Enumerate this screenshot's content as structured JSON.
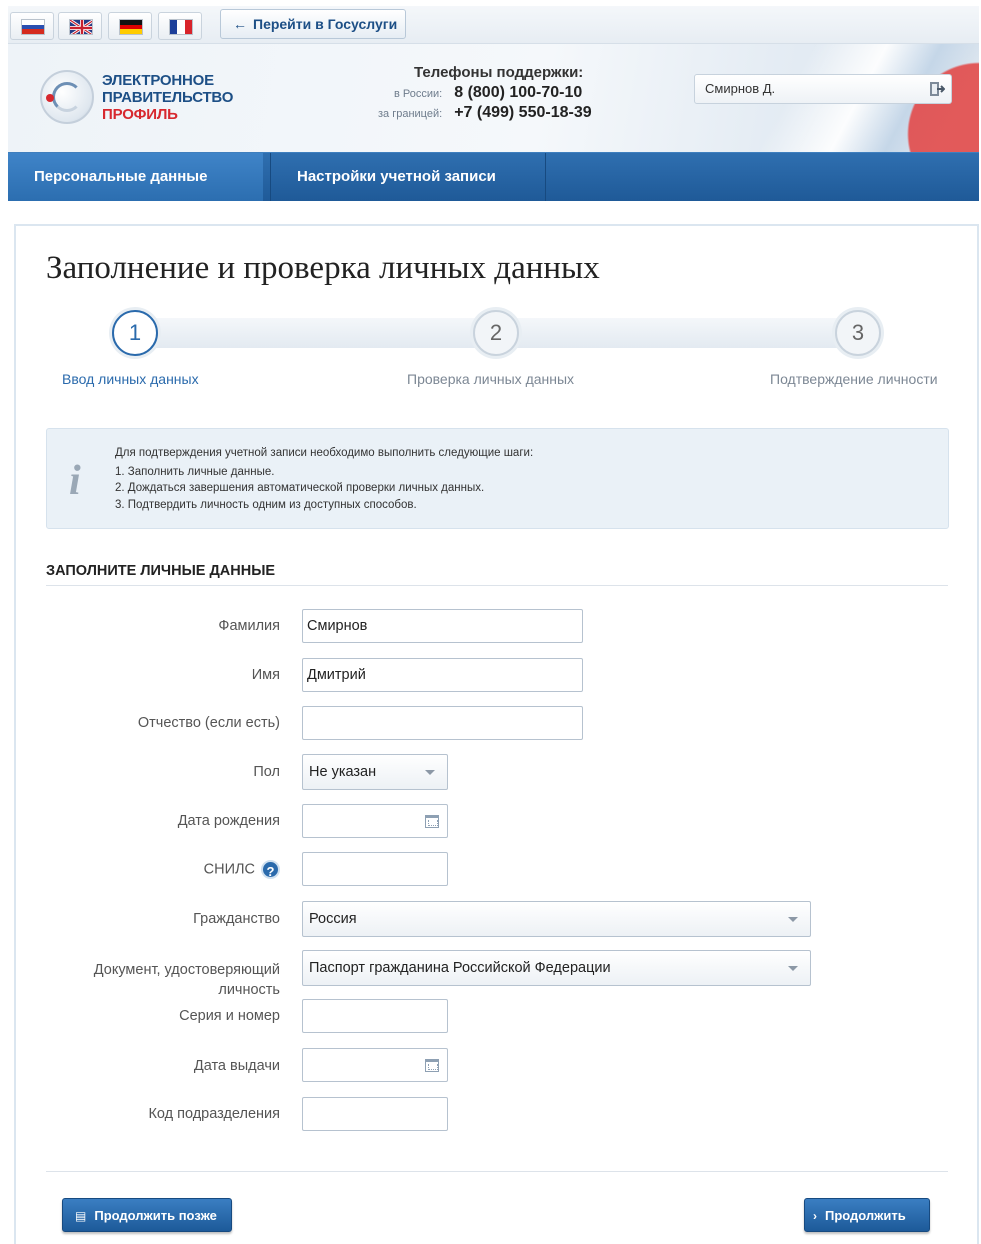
{
  "languages": [
    {
      "code": "ru",
      "label": ""
    },
    {
      "code": "en",
      "label": ""
    },
    {
      "code": "de",
      "label": ""
    },
    {
      "code": "fr",
      "label": ""
    }
  ],
  "goto_gosuslugi": "Перейти в Госуслуги",
  "logo": {
    "line1": "ЭЛЕКТРОННОЕ",
    "line2": "ПРАВИТЕЛЬСТВО",
    "line3": "ПРОФИЛЬ"
  },
  "support": {
    "title": "Телефоны поддержки:",
    "russia_label": "в России:",
    "russia_phone": "8 (800) 100-70-10",
    "abroad_label": "за границей:",
    "abroad_phone": "+7 (499) 550-18-39"
  },
  "user": {
    "name": "Смирнов Д."
  },
  "nav": {
    "tab_personal": "Персональные данные",
    "tab_settings": "Настройки учетной записи"
  },
  "page_title": "Заполнение и проверка личных данных",
  "steps": [
    {
      "number": "1",
      "label": "Ввод личных данных",
      "active": true
    },
    {
      "number": "2",
      "label": "Проверка личных данных",
      "active": false
    },
    {
      "number": "3",
      "label": "Подтверждение личности",
      "active": false
    }
  ],
  "info": {
    "icon": "i",
    "intro": "Для подтверждения учетной записи необходимо выполнить следующие шаги:",
    "items": [
      "1.  Заполнить личные данные.",
      "2.  Дождаться завершения автоматической проверки личных данных.",
      "3.  Подтвердить личность одним из доступных способов."
    ]
  },
  "section_title": "ЗАПОЛНИТЕ ЛИЧНЫЕ ДАННЫЕ",
  "form": {
    "surname": {
      "label": "Фамилия",
      "value": "Смирнов"
    },
    "name": {
      "label": "Имя",
      "value": "Дмитрий"
    },
    "patronymic": {
      "label": "Отчество (если есть)",
      "value": ""
    },
    "gender": {
      "label": "Пол",
      "value": "Не указан"
    },
    "birth_date": {
      "label": "Дата рождения",
      "value": ""
    },
    "snils": {
      "label": "СНИЛС",
      "value": "",
      "help": "?"
    },
    "citizenship": {
      "label": "Гражданство",
      "value": "Россия"
    },
    "document": {
      "label_line1": "Документ, удостоверяющий",
      "label_line2": "личность",
      "value": "Паспорт гражданина Российской Федерации"
    },
    "series_number": {
      "label": "Серия и номер",
      "value": ""
    },
    "issue_date": {
      "label": "Дата выдачи",
      "value": ""
    },
    "division_code": {
      "label": "Код подразделения",
      "value": ""
    }
  },
  "buttons": {
    "later": "Продолжить позже",
    "next": "Продолжить"
  }
}
